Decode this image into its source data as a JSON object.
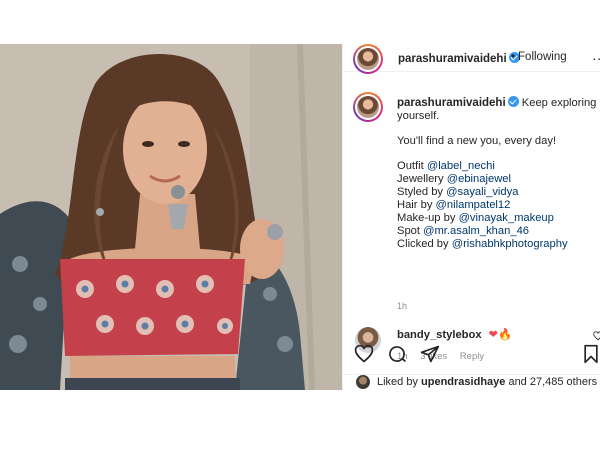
{
  "post": {
    "username": "parashuramivaidehi",
    "follow_state": "Following",
    "more_label": "...",
    "caption_lines": [
      "Keep exploring",
      "yourself.",
      "",
      "You'll find a new you, every day!",
      "",
      "Outfit ",
      "Jewellery ",
      "Styled by ",
      "Hair by ",
      "Make-up by ",
      "Spot ",
      "Clicked by "
    ],
    "credits": [
      {
        "label": "Outfit",
        "handle": "@label_nechi"
      },
      {
        "label": "Jewellery",
        "handle": "@ebinajewel"
      },
      {
        "label": "Styled by",
        "handle": "@sayali_vidya"
      },
      {
        "label": "Hair by",
        "handle": "@nilampatel12"
      },
      {
        "label": "Make-up by",
        "handle": "@vinayak_makeup"
      },
      {
        "label": "Spot",
        "handle": "@mr.asalm_khan_46"
      },
      {
        "label": "Clicked by",
        "handle": "@rishabhkphotography"
      }
    ],
    "caption_intro": "Keep exploring",
    "caption_intro_2": "yourself.",
    "caption_tagline": "You'll find a new you, every day!",
    "time": "1h"
  },
  "comment": {
    "username": "bandy_stylebox",
    "emoji_heart": "❤",
    "emoji_fire": "🔥",
    "time": "1h",
    "likes": "3 likes",
    "reply": "Reply"
  },
  "actions": {
    "icons": [
      "heart-icon",
      "comment-icon",
      "share-icon",
      "bookmark-icon"
    ]
  },
  "likes": {
    "prefix": "Liked by ",
    "user": "upendrasidhaye",
    "suffix": " and 27,485 others"
  },
  "colors": {
    "link": "#00376b",
    "verified": "#3897f0",
    "muted": "#8e8e8e"
  }
}
